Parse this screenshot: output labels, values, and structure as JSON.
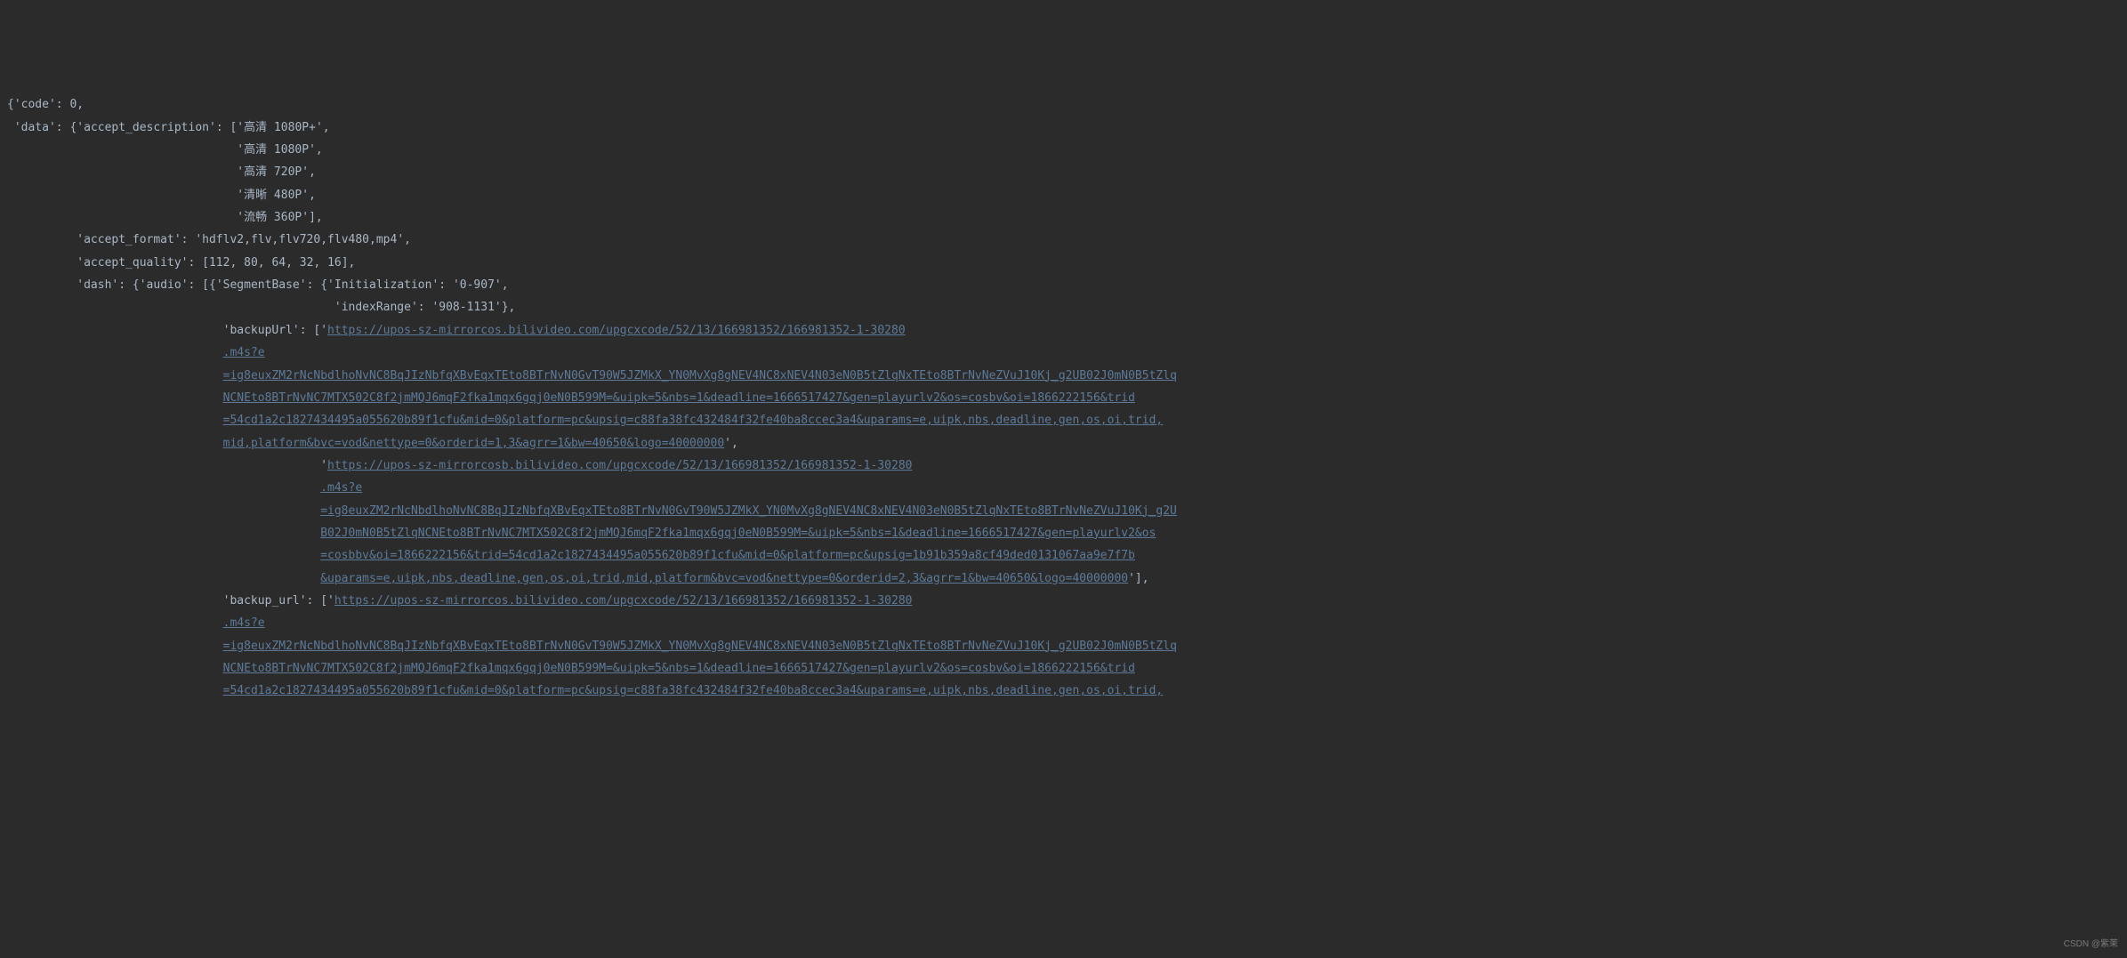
{
  "code_label": "code",
  "code_value": "0",
  "data_label": "data",
  "accept_description_label": "accept_description",
  "accept_description": [
    "高清 1080P+",
    "高清 1080P",
    "高清 720P",
    "清晰 480P",
    "流畅 360P"
  ],
  "accept_format_label": "accept_format",
  "accept_format_value": "hdflv2,flv,flv720,flv480,mp4",
  "accept_quality_label": "accept_quality",
  "accept_quality_values": [
    "112",
    "80",
    "64",
    "32",
    "16"
  ],
  "dash_label": "dash",
  "audio_label": "audio",
  "segmentbase_label": "SegmentBase",
  "initialization_label": "Initialization",
  "initialization_value": "0-907",
  "indexrange_label": "indexRange",
  "indexrange_value": "908-1131",
  "backupUrl_label": "backupUrl",
  "backup_url_label": "backup_url",
  "url1_part1": "https://upos-sz-mirrorcos.bilivideo.com/upgcxcode/52/13/166981352/166981352-1-30280",
  "url1_part2": ".m4s?e",
  "url1_part3": "=ig8euxZM2rNcNbdlhoNvNC8BqJIzNbfqXBvEqxTEto8BTrNvN0GvT90W5JZMkX_YN0MvXg8gNEV4NC8xNEV4N03eN0B5tZlqNxTEto8BTrNvNeZVuJ10Kj_g2UB02J0mN0B5tZlq",
  "url1_part4": "NCNEto8BTrNvNC7MTX502C8f2jmMQJ6mqF2fka1mqx6gqj0eN0B599M=&uipk=5&nbs=1&deadline=1666517427&gen=playurlv2&os=cosbv&oi=1866222156&trid",
  "url1_part5": "=54cd1a2c1827434495a055620b89f1cfu&mid=0&platform=pc&upsig=c88fa38fc432484f32fe40ba8ccec3a4&uparams=e,uipk,nbs,deadline,gen,os,oi,trid,",
  "url1_part6": "mid,platform&bvc=vod&nettype=0&orderid=1,3&agrr=1&bw=40650&logo=40000000",
  "url2_part1": "https://upos-sz-mirrorcosb.bilivideo.com/upgcxcode/52/13/166981352/166981352-1-30280",
  "url2_part2": ".m4s?e",
  "url2_part3": "=ig8euxZM2rNcNbdlhoNvNC8BqJIzNbfqXBvEqxTEto8BTrNvN0GvT90W5JZMkX_YN0MvXg8gNEV4NC8xNEV4N03eN0B5tZlqNxTEto8BTrNvNeZVuJ10Kj_g2U",
  "url2_part4": "B02J0mN0B5tZlqNCNEto8BTrNvNC7MTX502C8f2jmMQJ6mqF2fka1mqx6gqj0eN0B599M=&uipk=5&nbs=1&deadline=1666517427&gen=playurlv2&os",
  "url2_part5": "=cosbbv&oi=1866222156&trid=54cd1a2c1827434495a055620b89f1cfu&mid=0&platform=pc&upsig=1b91b359a8cf49ded0131067aa9e7f7b",
  "url2_part6": "&uparams=e,uipk,nbs,deadline,gen,os,oi,trid,mid,platform&bvc=vod&nettype=0&orderid=2,3&agrr=1&bw=40650&logo=40000000",
  "url3_part1": "https://upos-sz-mirrorcos.bilivideo.com/upgcxcode/52/13/166981352/166981352-1-30280",
  "url3_part2": ".m4s?e",
  "url3_part3": "=ig8euxZM2rNcNbdlhoNvNC8BqJIzNbfqXBvEqxTEto8BTrNvN0GvT90W5JZMkX_YN0MvXg8gNEV4NC8xNEV4N03eN0B5tZlqNxTEto8BTrNvNeZVuJ10Kj_g2UB02J0mN0B5tZlq",
  "url3_part4": "NCNEto8BTrNvNC7MTX502C8f2jmMQJ6mqF2fka1mqx6gqj0eN0B599M=&uipk=5&nbs=1&deadline=1666517427&gen=playurlv2&os=cosbv&oi=1866222156&trid",
  "url3_part5": "=54cd1a2c1827434495a055620b89f1cfu&mid=0&platform=pc&upsig=c88fa38fc432484f32fe40ba8ccec3a4&uparams=e,uipk,nbs,deadline,gen,os,oi,trid,",
  "watermark": "CSDN @紫茉"
}
